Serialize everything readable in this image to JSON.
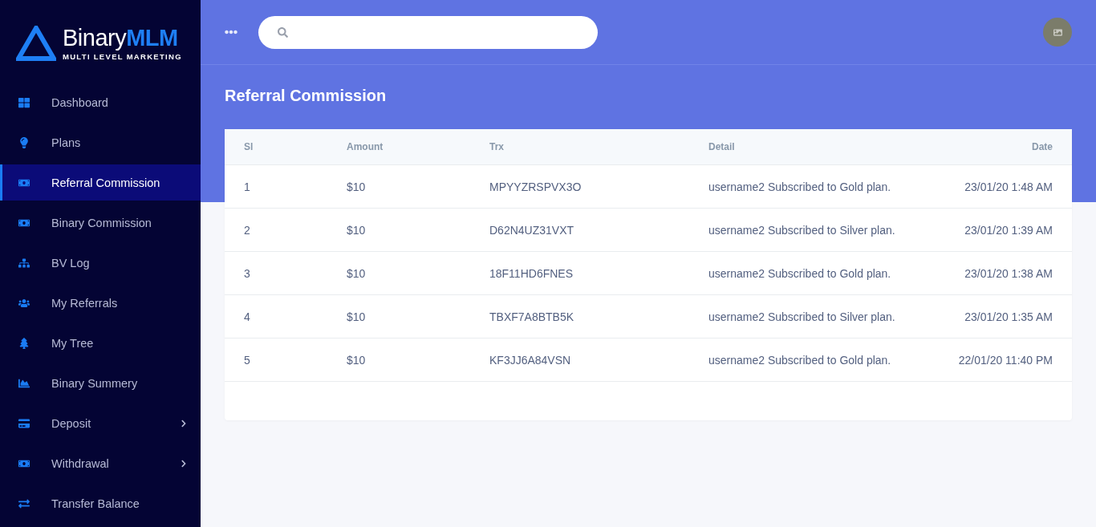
{
  "logo": {
    "name": "Binary",
    "accent": "MLM",
    "tagline": "MULTI LEVEL MARKETING"
  },
  "sidebar": {
    "items": [
      {
        "label": "Dashboard",
        "kind": "grid",
        "selected": false,
        "expandable": false
      },
      {
        "label": "Plans",
        "kind": "bulb",
        "selected": false,
        "expandable": false
      },
      {
        "label": "Referral Commission",
        "kind": "money",
        "selected": true,
        "expandable": false
      },
      {
        "label": "Binary Commission",
        "kind": "money",
        "selected": false,
        "expandable": false
      },
      {
        "label": "BV Log",
        "kind": "sitemap",
        "selected": false,
        "expandable": false
      },
      {
        "label": "My Referrals",
        "kind": "users",
        "selected": false,
        "expandable": false
      },
      {
        "label": "My Tree",
        "kind": "tree",
        "selected": false,
        "expandable": false
      },
      {
        "label": "Binary Summery",
        "kind": "chart",
        "selected": false,
        "expandable": false
      },
      {
        "label": "Deposit",
        "kind": "card",
        "selected": false,
        "expandable": true
      },
      {
        "label": "Withdrawal",
        "kind": "money",
        "selected": false,
        "expandable": true
      },
      {
        "label": "Transfer Balance",
        "kind": "transfer",
        "selected": false,
        "expandable": false
      }
    ]
  },
  "page": {
    "title": "Referral Commission"
  },
  "table": {
    "columns": [
      "Sl",
      "Amount",
      "Trx",
      "Detail",
      "Date"
    ],
    "rows": [
      [
        "1",
        "$10",
        "MPYYZRSPVX3O",
        "username2 Subscribed to Gold plan.",
        "23/01/20 1:48 AM"
      ],
      [
        "2",
        "$10",
        "D62N4UZ31VXT",
        "username2 Subscribed to Silver plan.",
        "23/01/20 1:39 AM"
      ],
      [
        "3",
        "$10",
        "18F11HD6FNES",
        "username2 Subscribed to Gold plan.",
        "23/01/20 1:38 AM"
      ],
      [
        "4",
        "$10",
        "TBXF7A8BTB5K",
        "username2 Subscribed to Silver plan.",
        "23/01/20 1:35 AM"
      ],
      [
        "5",
        "$10",
        "KF3JJ6A84VSN",
        "username2 Subscribed to Gold plan.",
        "22/01/20 11:40 PM"
      ]
    ]
  }
}
